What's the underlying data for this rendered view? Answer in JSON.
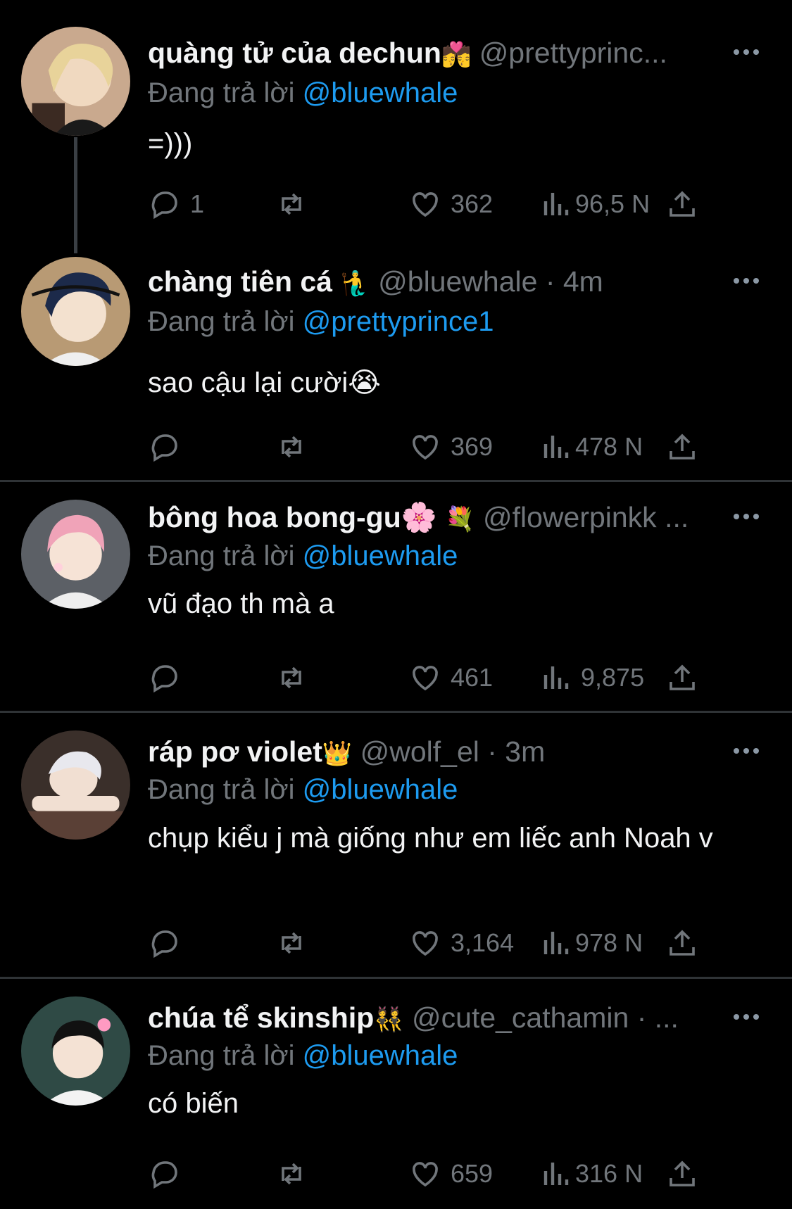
{
  "colors": {
    "background": "#000000",
    "text": "#e7e9ea",
    "muted": "#71767b",
    "mention": "#1d9bf0",
    "divider": "#2f3336"
  },
  "icons": {
    "reply": "reply-bubble-icon",
    "retweet": "retweet-icon",
    "like": "heart-icon",
    "views": "views-bars-icon",
    "share": "share-upload-icon",
    "more": "more-dots-icon"
  },
  "tweets": [
    {
      "display_name": "quàng tử của dechun",
      "name_emoji": "💏",
      "handle": "@prettyprinc...",
      "replying_label": "Đang trả lời",
      "replying_to": "@bluewhale",
      "text": "=)))",
      "replies": "1",
      "retweets": "",
      "likes": "362",
      "views": "96,5 N"
    },
    {
      "display_name": "chàng tiên cá",
      "name_emoji": "🧜‍♂️",
      "handle": "@bluewhale · 4m",
      "replying_label": "Đang trả lời",
      "replying_to": "@prettyprince1",
      "text": "sao cậu lại cười😭",
      "replies": "",
      "retweets": "",
      "likes": "369",
      "views": "478 N"
    },
    {
      "display_name": "bông hoa bong-gu🌸",
      "name_emoji": "💐",
      "handle": "@flowerpinkk ...",
      "replying_label": "Đang trả lời",
      "replying_to": "@bluewhale",
      "text": "vũ đạo th mà a",
      "replies": "",
      "retweets": "",
      "likes": "461",
      "views": "9,875"
    },
    {
      "display_name": "ráp pơ violet",
      "name_emoji": "👑",
      "handle": "@wolf_el · 3m",
      "replying_label": "Đang trả lời",
      "replying_to": "@bluewhale",
      "text": "chụp kiểu j mà giống như em liếc anh Noah v",
      "replies": "",
      "retweets": "",
      "likes": "3,164",
      "views": "978 N"
    },
    {
      "display_name": "chúa tể skinship",
      "name_emoji": "👯",
      "handle": "@cute_cathamin · ...",
      "replying_label": "Đang trả lời",
      "replying_to": "@bluewhale",
      "text": "có biến",
      "replies": "",
      "retweets": "",
      "likes": "659",
      "views": "316 N"
    }
  ]
}
